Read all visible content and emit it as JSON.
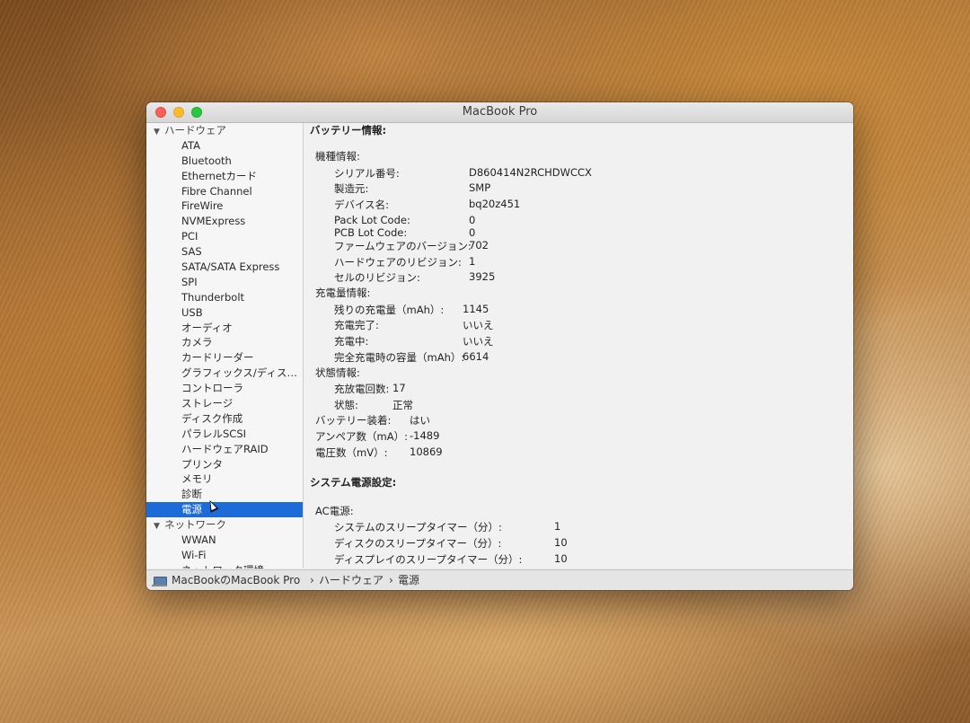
{
  "window": {
    "title": "MacBook Pro"
  },
  "sidebar": {
    "groups": [
      {
        "label": "ハードウェア"
      },
      {
        "label": "ネットワーク"
      }
    ],
    "hardware_items": [
      "ATA",
      "Bluetooth",
      "Ethernetカード",
      "Fibre Channel",
      "FireWire",
      "NVMExpress",
      "PCI",
      "SAS",
      "SATA/SATA Express",
      "SPI",
      "Thunderbolt",
      "USB",
      "オーディオ",
      "カメラ",
      "カードリーダー",
      "グラフィックス/ディス…",
      "コントローラ",
      "ストレージ",
      "ディスク作成",
      "パラレルSCSI",
      "ハードウェアRAID",
      "プリンタ",
      "メモリ",
      "診断",
      "電源"
    ],
    "network_items": [
      "WWAN",
      "Wi-Fi",
      "ネットワーク環境"
    ],
    "selected": "電源"
  },
  "content": {
    "battery_title": "バッテリー情報:",
    "model_info": {
      "label": "機種情報:",
      "rows": [
        {
          "k": "シリアル番号:",
          "v": "D860414N2RCHDWCCX"
        },
        {
          "k": "製造元:",
          "v": "SMP"
        },
        {
          "k": "デバイス名:",
          "v": "bq20z451"
        },
        {
          "k": "Pack Lot Code:",
          "v": "0"
        },
        {
          "k": "PCB Lot Code:",
          "v": "0"
        },
        {
          "k": "ファームウェアのバージョン:",
          "v": "702"
        },
        {
          "k": "ハードウェアのリビジョン:",
          "v": "1"
        },
        {
          "k": "セルのリビジョン:",
          "v": "3925"
        }
      ]
    },
    "charge_info": {
      "label": "充電量情報:",
      "rows": [
        {
          "k": "残りの充電量（mAh）:",
          "v": "1145"
        },
        {
          "k": "充電完了:",
          "v": "いいえ"
        },
        {
          "k": "充電中:",
          "v": "いいえ"
        },
        {
          "k": "完全充電時の容量（mAh）:",
          "v": "6614"
        }
      ]
    },
    "health_info": {
      "label": "状態情報:",
      "rows": [
        {
          "k": "充放電回数:",
          "v": "17"
        },
        {
          "k": "状態:",
          "v": "正常"
        }
      ]
    },
    "misc_rows": [
      {
        "k": "バッテリー装着:",
        "v": "はい"
      },
      {
        "k": "アンペア数（mA）:",
        "v": "-1489"
      },
      {
        "k": "電圧数（mV）:",
        "v": "10869"
      }
    ],
    "power_title": "システム電源設定:",
    "ac_power": {
      "label": "AC電源:",
      "rows": [
        {
          "k": "システムのスリープタイマー（分）:",
          "v": "1"
        },
        {
          "k": "ディスクのスリープタイマー（分）:",
          "v": "10"
        },
        {
          "k": "ディスプレイのスリープタイマー（分）:",
          "v": "10"
        }
      ]
    }
  },
  "statusbar": {
    "computer": "MacBookのMacBook Pro",
    "crumb1": "ハードウェア",
    "crumb2": "電源",
    "separator": "›"
  }
}
